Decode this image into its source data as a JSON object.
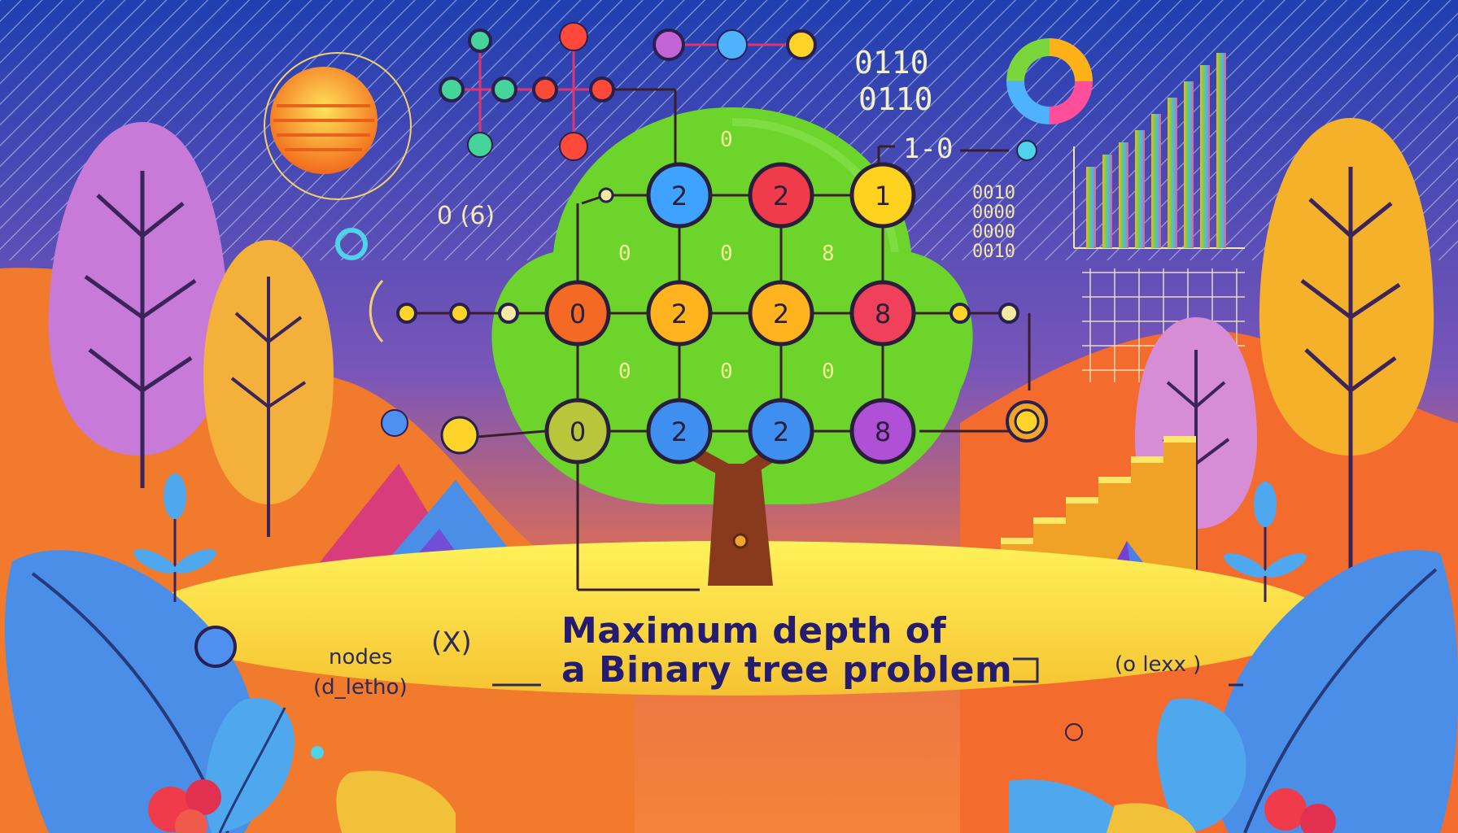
{
  "title_line1": "Maximum depth of",
  "title_line2": "a Binary tree problem",
  "nodes_label": "nodes",
  "nodes_sub_label": "(d_letho)",
  "x_label": "(X)",
  "right_label": "(o lexx )",
  "binary_top_1": "0110",
  "binary_top_2": "0110",
  "binary_mid": "1-0",
  "left_code": "0 (6)",
  "tree_node_values": {
    "row1": [
      "2",
      "2",
      "1"
    ],
    "row2": [
      "0",
      "2",
      "2",
      "8"
    ],
    "row3": [
      "0",
      "2",
      "2",
      "8"
    ]
  },
  "small_numbers": [
    "0",
    "0",
    "0",
    "8",
    "0",
    "0",
    "0"
  ],
  "binary_grid": [
    "0010",
    "0000",
    "0000",
    "0010"
  ],
  "colors": {
    "sky": "#3b4fb3",
    "ground": "#f48a2c",
    "foliage": "#6cd42b",
    "accent_pink": "#d43b8a",
    "accent_yellow": "#f3c22a"
  }
}
